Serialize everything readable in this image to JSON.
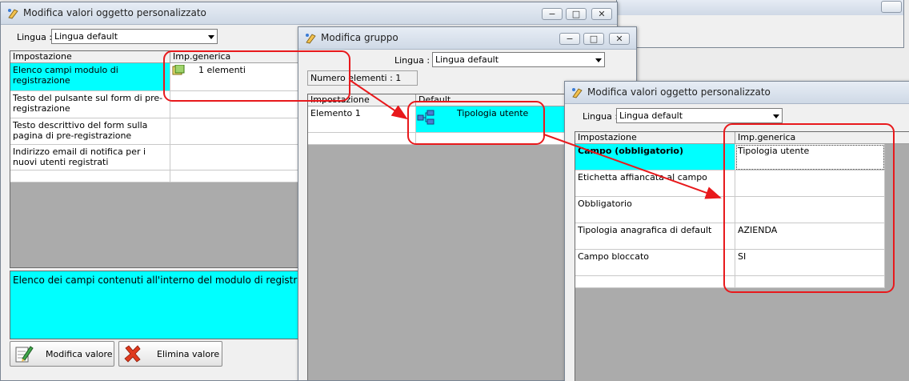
{
  "colors": {
    "highlight": "#00ffff",
    "annotation": "#e8191c",
    "grid_bg": "#ababab"
  },
  "background_window": {},
  "main_window": {
    "title": "Modifica valori oggetto personalizzato",
    "language_label": "Lingua :",
    "language_value": "Lingua default",
    "columns": [
      "Impostazione",
      "Imp.generica"
    ],
    "rows": [
      {
        "setting": "Elenco campi modulo di registrazione",
        "value": "1 elementi",
        "selected": true,
        "icon": "element-list-icon"
      },
      {
        "setting": "Testo del pulsante sul form di pre-registrazione",
        "value": ""
      },
      {
        "setting": "Testo descrittivo del form sulla pagina di pre-registrazione",
        "value": ""
      },
      {
        "setting": "Indirizzo email di notifica per i nuovi utenti registrati",
        "value": ""
      }
    ],
    "description": "Elenco dei campi contenuti all'interno del modulo di registrazio",
    "buttons": {
      "edit": "Modifica valore",
      "delete": "Elimina valore"
    }
  },
  "group_window": {
    "title": "Modifica gruppo",
    "language_label": "Lingua :",
    "language_value": "Lingua default",
    "count_text": "Numero elementi : 1",
    "columns": [
      "Impostazione",
      "Default"
    ],
    "rows": [
      {
        "setting": "Elemento 1",
        "value": "Tipologia utente",
        "icon": "hierarchy-icon"
      }
    ]
  },
  "detail_window": {
    "title": "Modifica valori oggetto personalizzato",
    "language_label": "Lingua :",
    "language_value": "Lingua default",
    "columns": [
      "Impostazione",
      "Imp.generica"
    ],
    "rows": [
      {
        "setting": "Campo (obbligatorio)",
        "value": "Tipologia utente",
        "selected": true,
        "bold": true
      },
      {
        "setting": "Etichetta affiancata al campo",
        "value": ""
      },
      {
        "setting": "Obbligatorio",
        "value": ""
      },
      {
        "setting": "Tipologia anagrafica di default",
        "value": "AZIENDA"
      },
      {
        "setting": "Campo bloccato",
        "value": "SI"
      }
    ]
  },
  "window_controls": {
    "minimize": "−",
    "maximize": "□",
    "close": "✕"
  }
}
